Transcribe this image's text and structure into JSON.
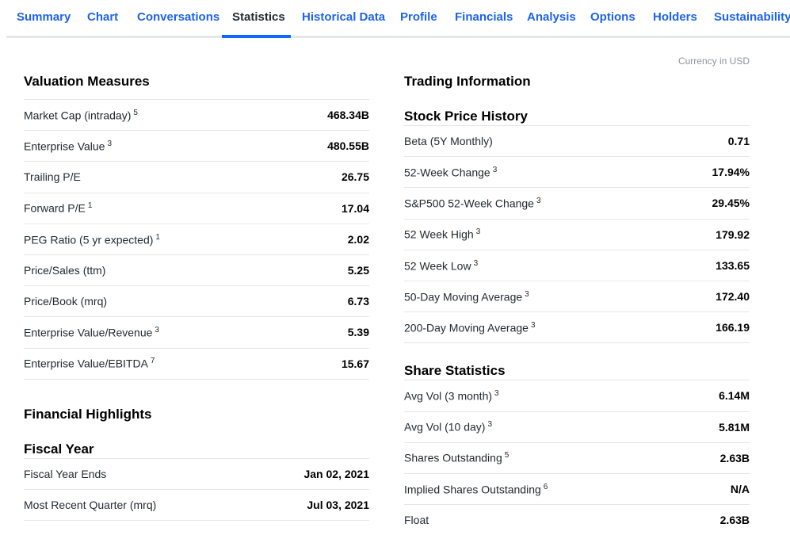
{
  "tabs": [
    {
      "label": "Summary",
      "active": false
    },
    {
      "label": "Chart",
      "active": false
    },
    {
      "label": "Conversations",
      "active": false
    },
    {
      "label": "Statistics",
      "active": true
    },
    {
      "label": "Historical Data",
      "active": false
    },
    {
      "label": "Profile",
      "active": false
    },
    {
      "label": "Financials",
      "active": false
    },
    {
      "label": "Analysis",
      "active": false
    },
    {
      "label": "Options",
      "active": false
    },
    {
      "label": "Holders",
      "active": false
    },
    {
      "label": "Sustainability",
      "active": false
    }
  ],
  "currency_note": "Currency in USD",
  "valuation": {
    "title": "Valuation Measures",
    "rows": [
      {
        "label": "Market Cap (intraday)",
        "note": "5",
        "value": "468.34B"
      },
      {
        "label": "Enterprise Value",
        "note": "3",
        "value": "480.55B"
      },
      {
        "label": "Trailing P/E",
        "note": "",
        "value": "26.75"
      },
      {
        "label": "Forward P/E",
        "note": "1",
        "value": "17.04"
      },
      {
        "label": "PEG Ratio (5 yr expected)",
        "note": "1",
        "value": "2.02"
      },
      {
        "label": "Price/Sales (ttm)",
        "note": "",
        "value": "5.25"
      },
      {
        "label": "Price/Book (mrq)",
        "note": "",
        "value": "6.73"
      },
      {
        "label": "Enterprise Value/Revenue",
        "note": "3",
        "value": "5.39"
      },
      {
        "label": "Enterprise Value/EBITDA",
        "note": "7",
        "value": "15.67"
      }
    ]
  },
  "financial_highlights": {
    "title": "Financial Highlights",
    "fiscal_year": {
      "title": "Fiscal Year",
      "rows": [
        {
          "label": "Fiscal Year Ends",
          "note": "",
          "value": "Jan 02, 2021"
        },
        {
          "label": "Most Recent Quarter (mrq)",
          "note": "",
          "value": "Jul 03, 2021"
        }
      ]
    }
  },
  "trading_information": {
    "title": "Trading Information",
    "stock_price_history": {
      "title": "Stock Price History",
      "rows": [
        {
          "label": "Beta (5Y Monthly)",
          "note": "",
          "value": "0.71"
        },
        {
          "label": "52-Week Change",
          "note": "3",
          "value": "17.94%"
        },
        {
          "label": "S&P500 52-Week Change",
          "note": "3",
          "value": "29.45%"
        },
        {
          "label": "52 Week High",
          "note": "3",
          "value": "179.92"
        },
        {
          "label": "52 Week Low",
          "note": "3",
          "value": "133.65"
        },
        {
          "label": "50-Day Moving Average",
          "note": "3",
          "value": "172.40"
        },
        {
          "label": "200-Day Moving Average",
          "note": "3",
          "value": "166.19"
        }
      ]
    },
    "share_statistics": {
      "title": "Share Statistics",
      "rows": [
        {
          "label": "Avg Vol (3 month)",
          "note": "3",
          "value": "6.14M"
        },
        {
          "label": "Avg Vol (10 day)",
          "note": "3",
          "value": "5.81M"
        },
        {
          "label": "Shares Outstanding",
          "note": "5",
          "value": "2.63B"
        },
        {
          "label": "Implied Shares Outstanding",
          "note": "6",
          "value": "N/A"
        },
        {
          "label": "Float",
          "note": "",
          "value": "2.63B"
        }
      ]
    }
  }
}
